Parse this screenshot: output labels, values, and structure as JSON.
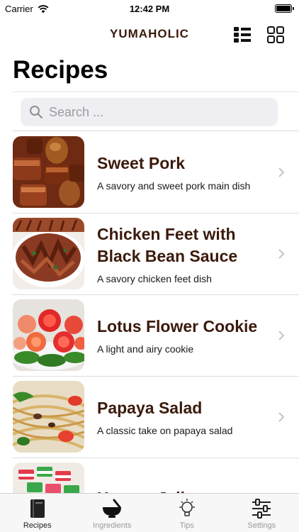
{
  "status_bar": {
    "carrier": "Carrier",
    "time": "12:42 PM"
  },
  "nav": {
    "brand": "YUMAHOLIC"
  },
  "page": {
    "title": "Recipes"
  },
  "search": {
    "placeholder": "Search ..."
  },
  "recipes": [
    {
      "name": "Sweet Pork",
      "description": "A savory and sweet pork main dish",
      "thumb": "sweet-pork-image"
    },
    {
      "name": "Chicken Feet with Black Bean Sauce",
      "description": "A savory chicken feet dish",
      "thumb": "chicken-feet-image"
    },
    {
      "name": "Lotus Flower Cookie",
      "description": "A light and airy cookie",
      "thumb": "lotus-cookie-image"
    },
    {
      "name": "Papaya Salad",
      "description": "A classic take on papaya salad",
      "thumb": "papaya-salad-image"
    },
    {
      "name": "Hmong Jello",
      "description": "",
      "thumb": "hmong-jello-image"
    }
  ],
  "tabs": [
    {
      "label": "Recipes",
      "icon": "book-icon",
      "active": true
    },
    {
      "label": "Ingredients",
      "icon": "mortar-pestle-icon",
      "active": false
    },
    {
      "label": "Tips",
      "icon": "lightbulb-icon",
      "active": false
    },
    {
      "label": "Settings",
      "icon": "sliders-icon",
      "active": false
    }
  ],
  "colors": {
    "accent": "#3b1a0c",
    "search_bg": "#efeff3",
    "tab_bar_bg": "#f7f7f7"
  }
}
